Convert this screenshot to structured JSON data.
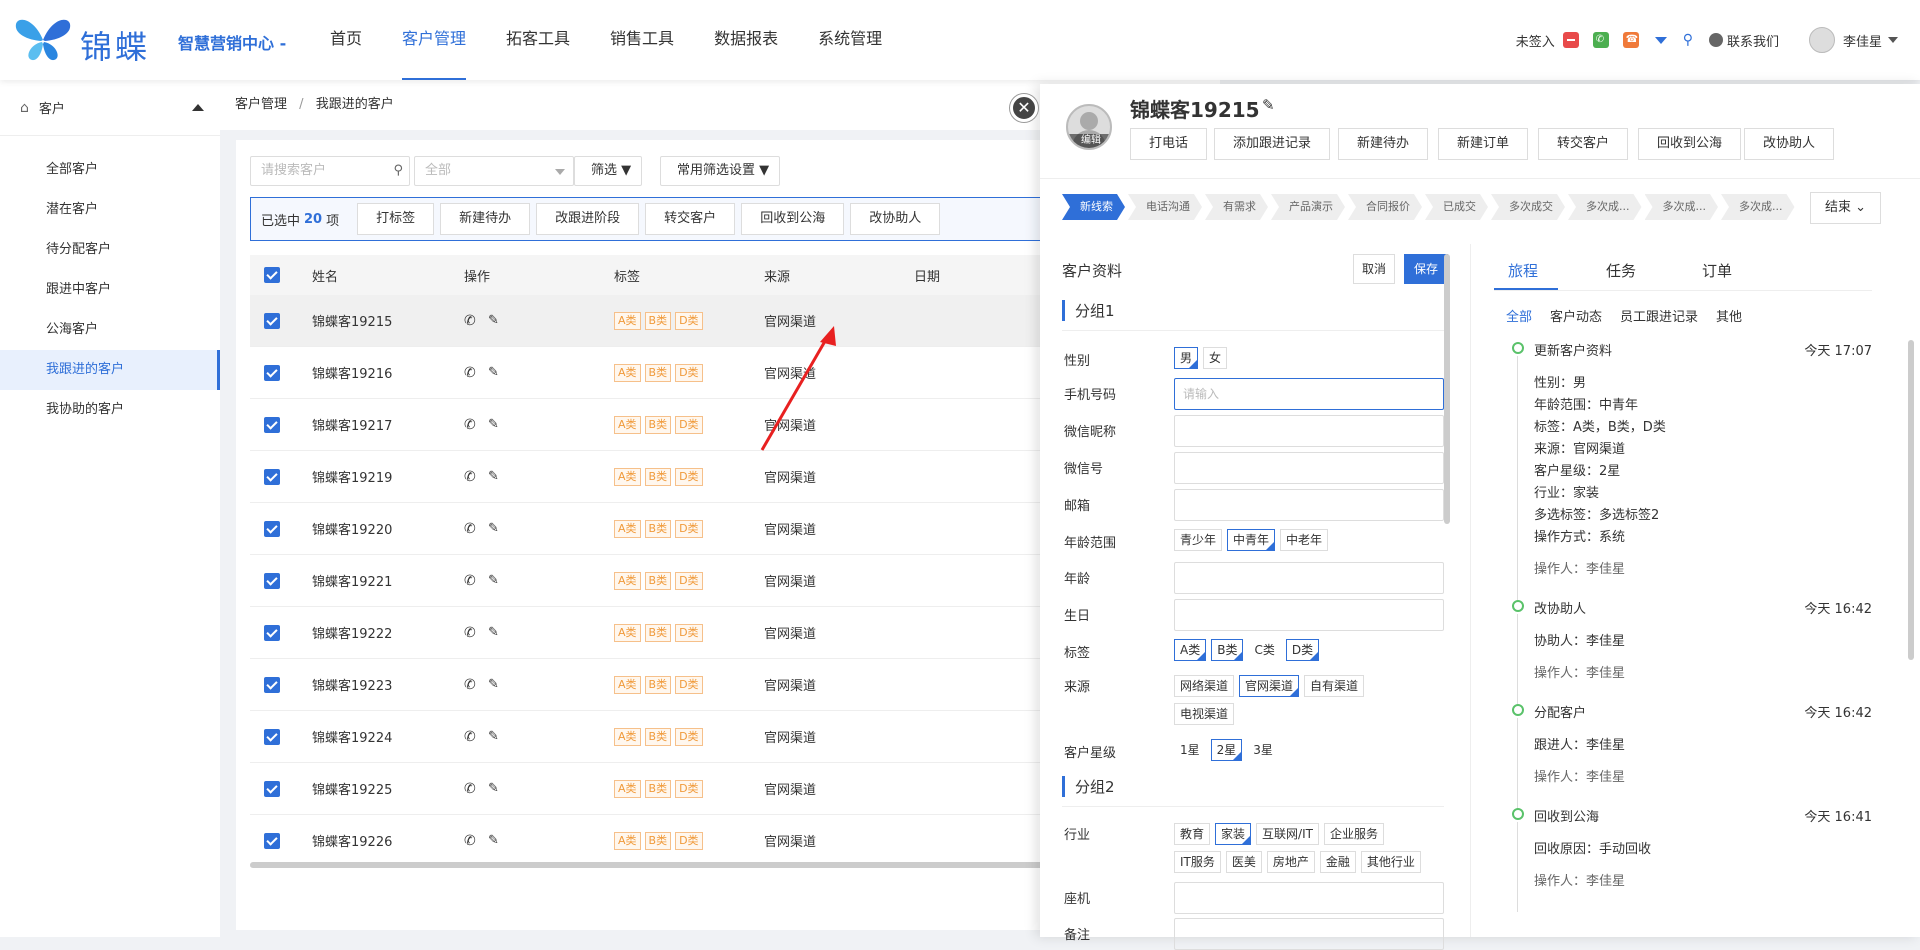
{
  "header": {
    "brand": "锦蝶",
    "tagline": "智慧营销中心 -",
    "nav": [
      "首页",
      "客户管理",
      "拓客工具",
      "销售工具",
      "数据报表",
      "系统管理"
    ],
    "checkin": "未签入",
    "contact": "联系我们",
    "user": "李佳星"
  },
  "sidebar": {
    "title": "客户",
    "items": [
      "全部客户",
      "潜在客户",
      "待分配客户",
      "跟进中客户",
      "公海客户",
      "我跟进的客户",
      "我协助的客户"
    ]
  },
  "breadcrumb": {
    "root": "客户管理",
    "sep": "/",
    "current": "我跟进的客户"
  },
  "toolbar": {
    "search_placeholder": "请搜索客户",
    "select_value": "全部",
    "filter": "筛选",
    "common_filter": "常用筛选设置"
  },
  "selection": {
    "prefix": "已选中",
    "count": "20",
    "suffix": "项",
    "actions": [
      "打标签",
      "新建待办",
      "改跟进阶段",
      "转交客户",
      "回收到公海",
      "改协助人"
    ]
  },
  "table": {
    "headers": [
      "姓名",
      "操作",
      "标签",
      "来源",
      "日期"
    ],
    "tags": [
      "A类",
      "B类",
      "D类"
    ],
    "source": "官网渠道",
    "rows": [
      "锦蝶客19215",
      "锦蝶客19216",
      "锦蝶客19217",
      "锦蝶客19219",
      "锦蝶客19220",
      "锦蝶客19221",
      "锦蝶客19222",
      "锦蝶客19223",
      "锦蝶客19224",
      "锦蝶客19225",
      "锦蝶客19226"
    ]
  },
  "drawer": {
    "name": "锦蝶客19215",
    "avatar_edit": "编辑",
    "actions": [
      "打电话",
      "添加跟进记录",
      "新建待办",
      "新建订单",
      "转交客户",
      "回收到公海",
      "改协助人"
    ],
    "stages": [
      "新线索",
      "电话沟通",
      "有需求",
      "产品演示",
      "合同报价",
      "已成交",
      "多次成交",
      "多次成...",
      "多次成...",
      "多次成..."
    ],
    "end": "结束",
    "profile_title": "客户资料",
    "cancel": "取消",
    "save": "保存",
    "group1": "分组1",
    "group2": "分组2",
    "labels": {
      "gender": "性别",
      "phone": "手机号码",
      "wechat_nick": "微信昵称",
      "wechat": "微信号",
      "email": "邮箱",
      "age_range": "年龄范围",
      "age": "年龄",
      "birthday": "生日",
      "tags": "标签",
      "source": "来源",
      "star": "客户星级",
      "industry": "行业",
      "landline": "座机",
      "remark": "备注"
    },
    "phone_placeholder": "请输入",
    "gender_opts": [
      "男",
      "女"
    ],
    "age_opts": [
      "青少年",
      "中青年",
      "中老年"
    ],
    "tag_opts": [
      "A类",
      "B类",
      "C类",
      "D类"
    ],
    "source_opts": [
      "网络渠道",
      "官网渠道",
      "自有渠道",
      "电视渠道"
    ],
    "star_opts": [
      "1星",
      "2星",
      "3星"
    ],
    "industry_opts": [
      "教育",
      "家装",
      "互联网/IT",
      "企业服务",
      "IT服务",
      "医美",
      "房地产",
      "金融",
      "其他行业"
    ],
    "tabs": [
      "旅程",
      "任务",
      "订单"
    ],
    "subtabs": [
      "全部",
      "客户动态",
      "员工跟进记录",
      "其他"
    ],
    "timeline": [
      {
        "title": "更新客户资料",
        "time": "今天 17:07",
        "lines": [
          "性别：男",
          "年龄范围：中青年",
          "标签：A类，B类，D类",
          "来源：官网渠道",
          "客户星级：2星",
          "行业：家装",
          "多选标签：多选标签2",
          "操作方式：系统"
        ],
        "op": "操作人：李佳星"
      },
      {
        "title": "改协助人",
        "time": "今天 16:42",
        "lines": [
          "协助人：李佳星"
        ],
        "op": "操作人：李佳星"
      },
      {
        "title": "分配客户",
        "time": "今天 16:42",
        "lines": [
          "跟进人：李佳星"
        ],
        "op": "操作人：李佳星"
      },
      {
        "title": "回收到公海",
        "time": "今天 16:41",
        "lines": [
          "回收原因：手动回收"
        ],
        "op": "操作人：李佳星"
      }
    ]
  }
}
